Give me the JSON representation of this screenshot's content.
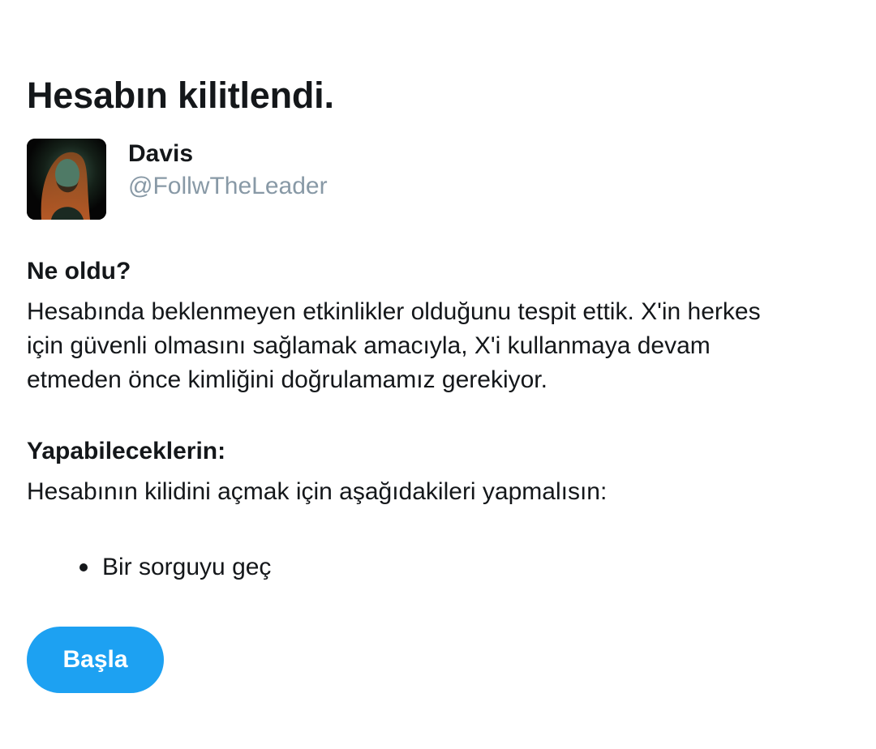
{
  "page": {
    "title": "Hesabın kilitlendi."
  },
  "account": {
    "display_name": "Davis",
    "handle": "@FollwTheLeader",
    "avatar_icon": "profile-photo"
  },
  "what_happened": {
    "heading": "Ne oldu?",
    "lines": [
      "Hesabında beklenmeyen etkinlikler olduğunu tespit ettik. X'in herkes",
      "için güvenli olmasını sağlamak amacıyla, X'i kullanmaya devam",
      "etmeden önce kimliğini doğrulamamız gerekiyor."
    ]
  },
  "what_you_can_do": {
    "heading": "Yapabileceklerin:",
    "text": "Hesabının kilidini açmak için aşağıdakileri yapmalısın:",
    "steps": [
      "Bir sorguyu geç"
    ]
  },
  "actions": {
    "start_label": "Başla"
  },
  "colors": {
    "text_primary": "#14171a",
    "text_secondary": "#8899a6",
    "button_bg": "#1da1f2",
    "button_text": "#ffffff"
  }
}
